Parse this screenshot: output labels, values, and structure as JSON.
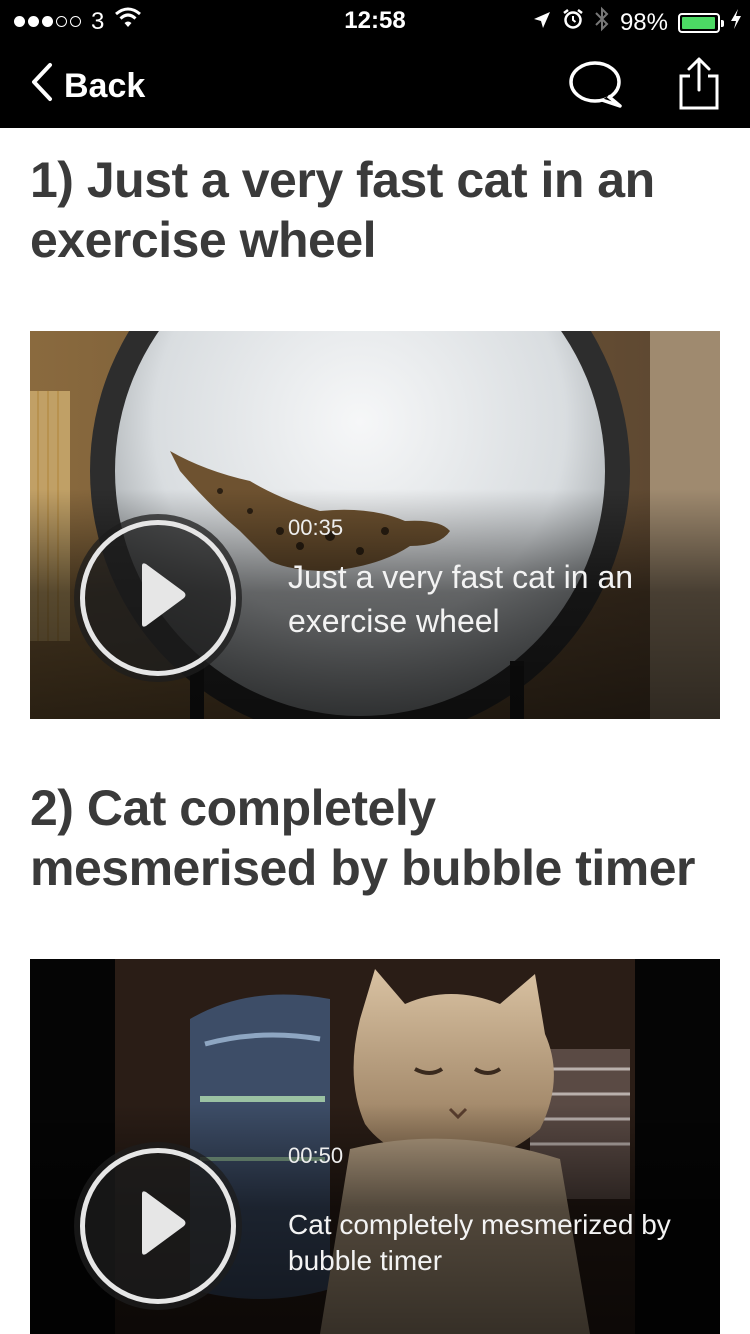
{
  "status_bar": {
    "carrier": "3",
    "time": "12:58",
    "battery_percent": "98%",
    "battery_level": 0.98,
    "icons": [
      "signal-dots-icon",
      "wifi-icon",
      "location-arrow-icon",
      "alarm-icon",
      "bluetooth-icon",
      "battery-icon",
      "charging-bolt-icon"
    ]
  },
  "nav": {
    "back_label": "Back",
    "icons": [
      "chevron-left-icon",
      "comment-bubble-icon",
      "share-icon"
    ]
  },
  "articles": [
    {
      "headline": "1) Just a very fast cat in an exercise wheel",
      "video": {
        "duration": "00:35",
        "title": "Just a very fast cat in an exercise wheel"
      }
    },
    {
      "headline": "2) Cat completely mesmerised by bubble timer",
      "video": {
        "duration": "00:50",
        "title": "Cat completely mesmerized by bubble timer"
      }
    }
  ],
  "colors": {
    "bar_bg": "#000000",
    "headline": "#3a3a3a",
    "battery": "#4cd964"
  }
}
